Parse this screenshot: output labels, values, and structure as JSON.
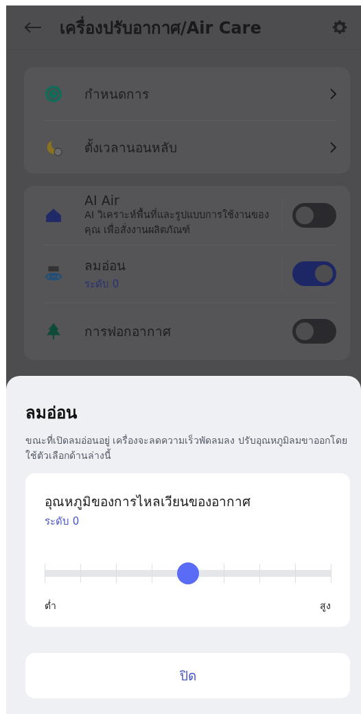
{
  "header": {
    "title": "เครื่องปรับอากาศ/Air Care"
  },
  "menu_card": {
    "items": [
      {
        "label": "กำหนดการ"
      },
      {
        "label": "ตั้งเวลานอนหลับ"
      }
    ]
  },
  "feature_card": {
    "items": [
      {
        "kind": "toggle",
        "title": "AI Air",
        "description": "AI วิเคราะห์พื้นที่และรูปแบบการใช้งานของคุณ เพื่อสั่งงานผลิตภัณฑ์",
        "on": false
      },
      {
        "kind": "toggle",
        "title": "ลมอ่อน",
        "subtitle": "ระดับ 0",
        "on": true
      },
      {
        "kind": "toggle",
        "title": "การฟอกอากาศ",
        "on": false
      }
    ]
  },
  "sheet": {
    "title": "ลมอ่อน",
    "description": "ขณะที่เปิดลมอ่อนอยู่ เครื่องจะลดความเร็วพัดลมลง ปรับอุณหภูมิลมขาออกโดยใช้ตัวเลือกด้านล่างนี้",
    "slider": {
      "label": "อุณหภูมิของการไหลเวียนของอากาศ",
      "reading": "ระดับ 0",
      "level": 0.5,
      "min_label": "ต่ำ",
      "max_label": "สูง"
    },
    "close_button": "ปิด"
  }
}
